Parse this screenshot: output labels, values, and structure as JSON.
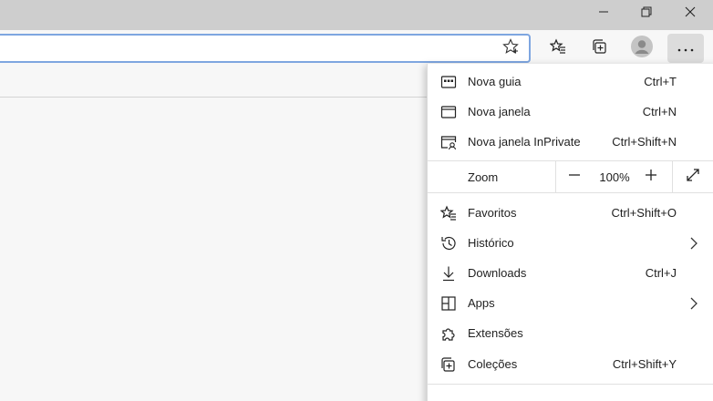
{
  "window": {
    "controls": [
      "minimize-icon",
      "restore-icon",
      "close-icon"
    ]
  },
  "toolbar": {
    "icons": [
      "favorite-star-icon",
      "favorites-icon",
      "collections-icon",
      "profile-avatar-icon",
      "more-icon"
    ]
  },
  "menu": {
    "items_top": [
      {
        "label": "Nova guia",
        "shortcut": "Ctrl+T",
        "icon": "new-tab-icon"
      },
      {
        "label": "Nova janela",
        "shortcut": "Ctrl+N",
        "icon": "new-window-icon"
      },
      {
        "label": "Nova janela InPrivate",
        "shortcut": "Ctrl+Shift+N",
        "icon": "inprivate-icon"
      }
    ],
    "zoom": {
      "label": "Zoom",
      "value": "100%",
      "minus": "−",
      "plus": "+"
    },
    "items_bottom": [
      {
        "label": "Favoritos",
        "shortcut": "Ctrl+Shift+O",
        "icon": "favorites-list-icon"
      },
      {
        "label": "Histórico",
        "shortcut": "",
        "icon": "history-icon",
        "submenu": true
      },
      {
        "label": "Downloads",
        "shortcut": "Ctrl+J",
        "icon": "download-icon"
      },
      {
        "label": "Apps",
        "shortcut": "",
        "icon": "apps-icon",
        "submenu": true
      },
      {
        "label": "Extensões",
        "shortcut": "",
        "icon": "extensions-icon"
      },
      {
        "label": "Coleções",
        "shortcut": "Ctrl+Shift+Y",
        "icon": "collections-menu-icon"
      }
    ]
  },
  "colors": {
    "titlebar": "#cecece",
    "address_border": "#7ea6e0",
    "menu_bg": "#ffffff",
    "page_bg": "#f7f7f7"
  }
}
